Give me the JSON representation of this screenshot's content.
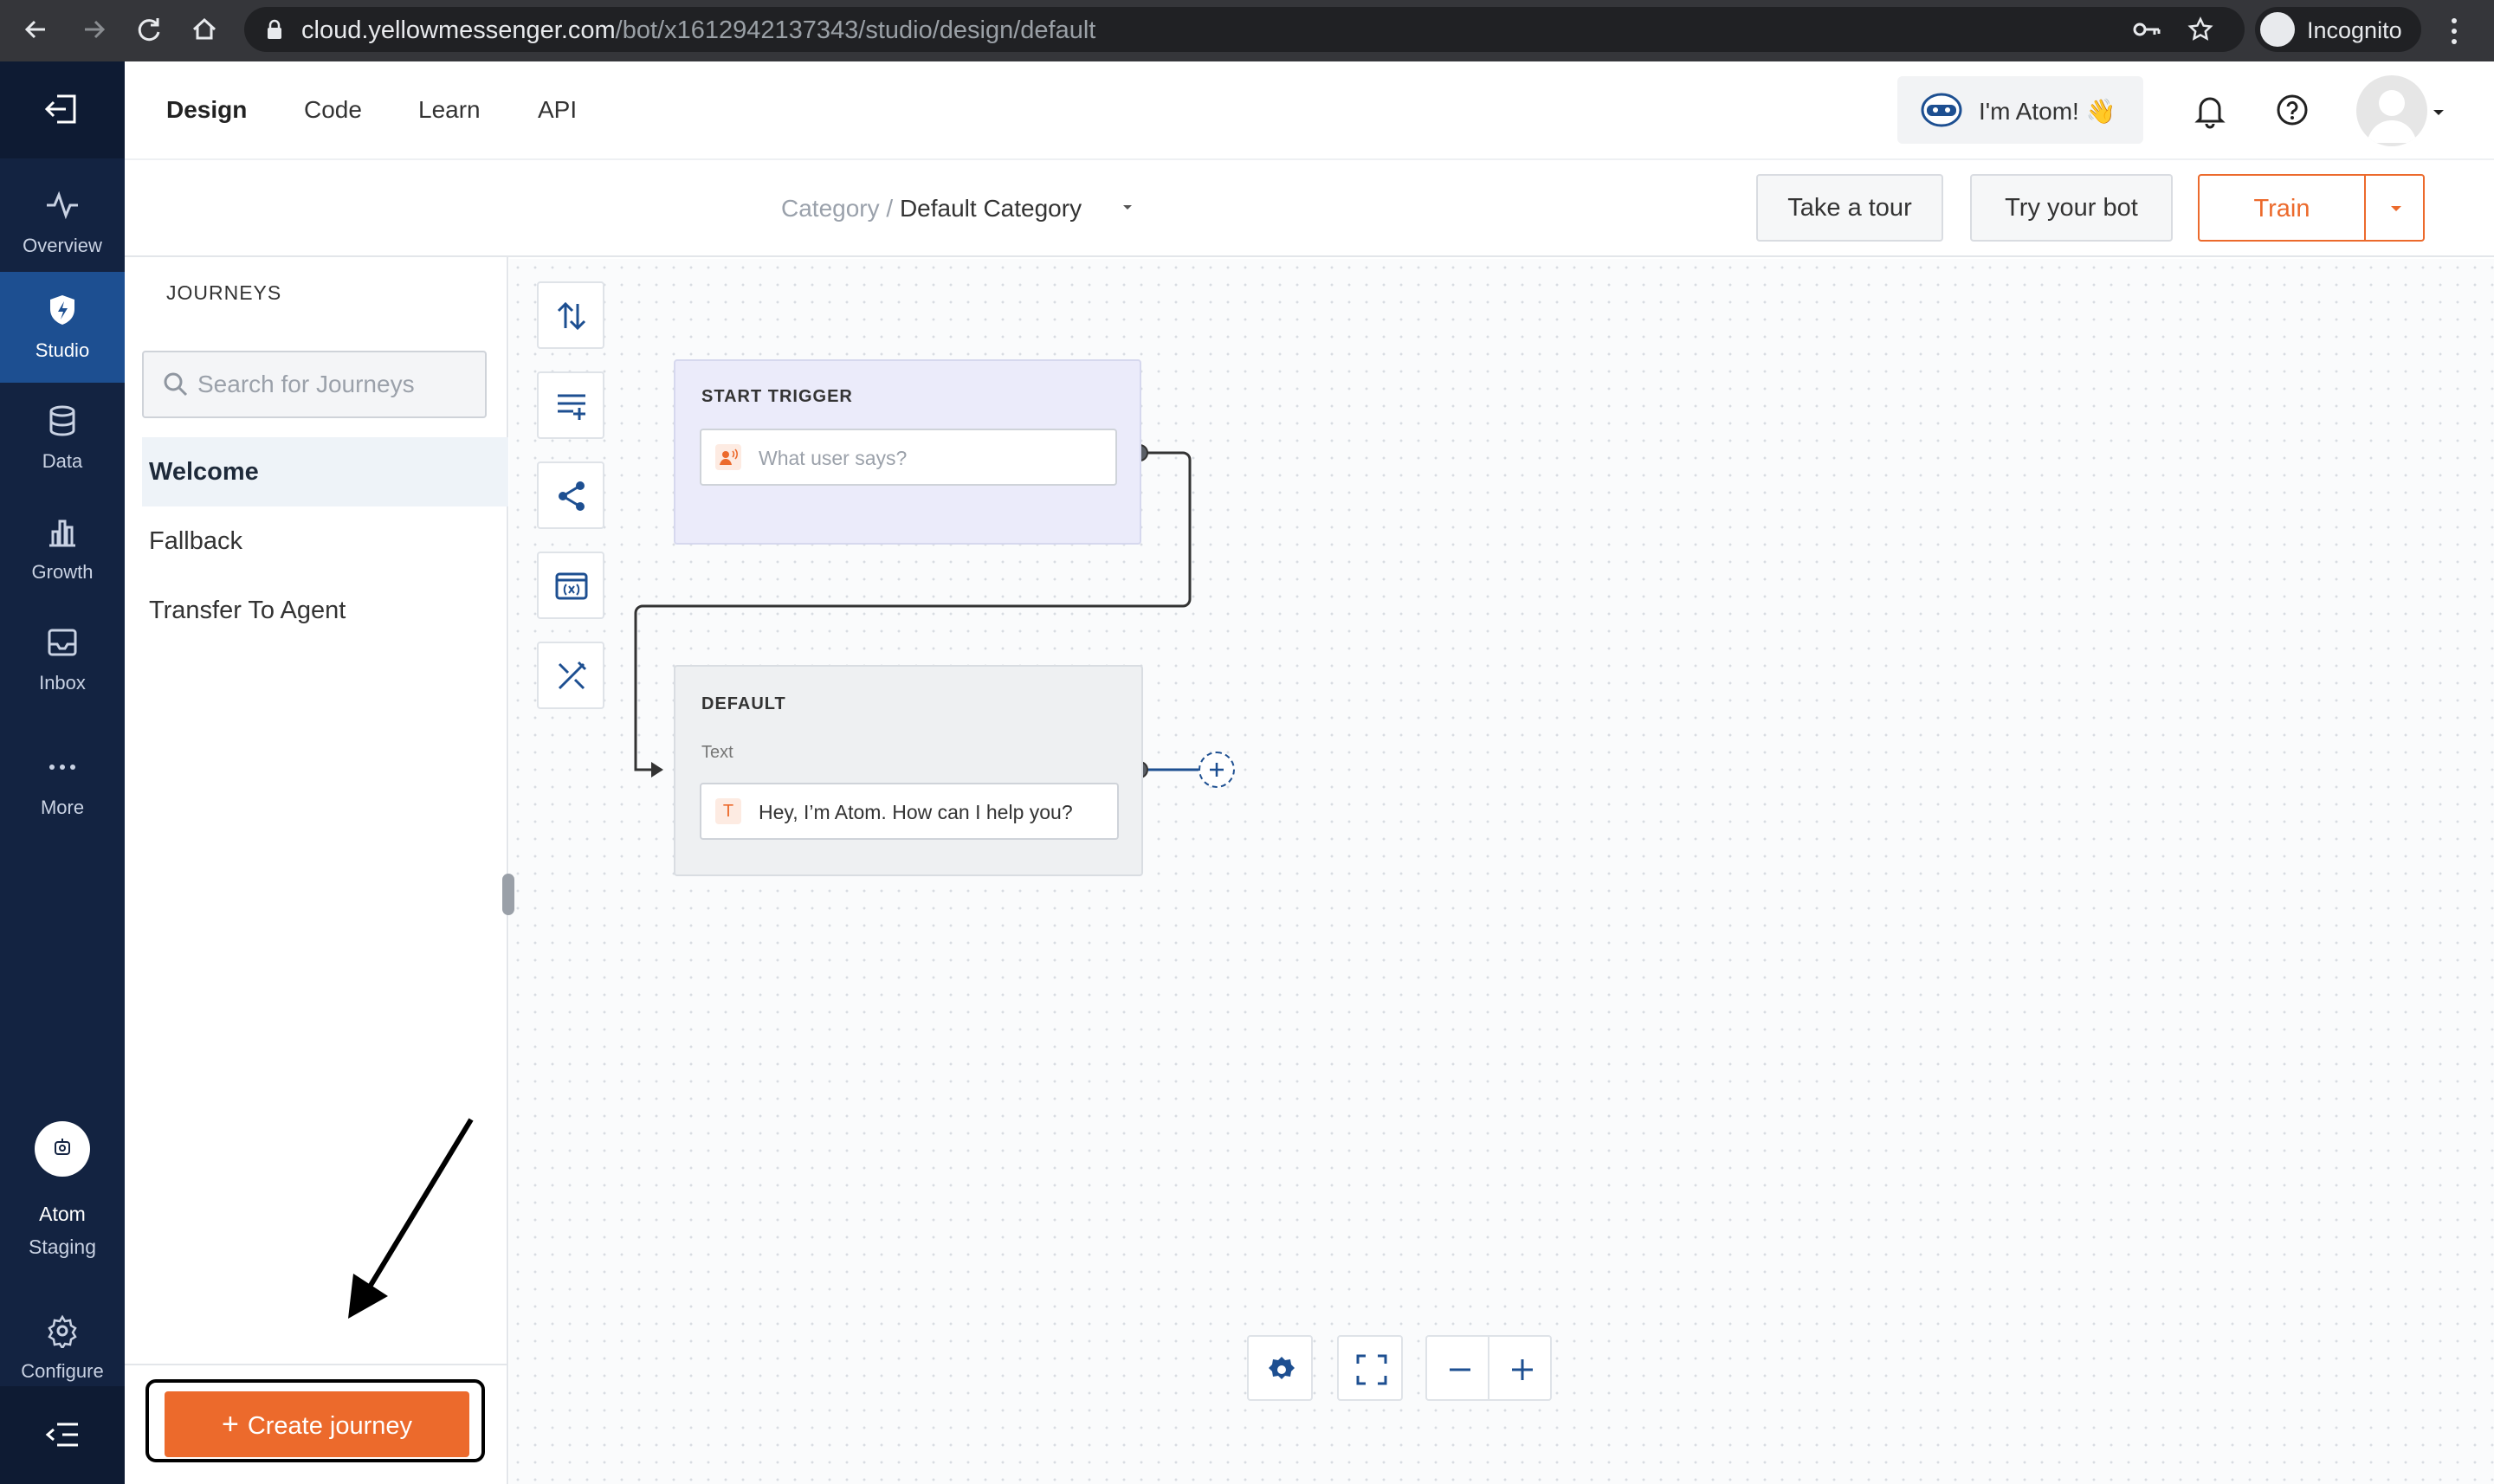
{
  "browser": {
    "url_host": "cloud.yellowmessenger.com",
    "url_path": "/bot/x1612942137343/studio/design/default",
    "incognito_label": "Incognito"
  },
  "leftnav": {
    "items": [
      {
        "label": "Overview",
        "icon": "activity-icon"
      },
      {
        "label": "Studio",
        "icon": "shield-bolt-icon",
        "active": true
      },
      {
        "label": "Data",
        "icon": "database-icon"
      },
      {
        "label": "Growth",
        "icon": "bar-chart-icon"
      },
      {
        "label": "Inbox",
        "icon": "inbox-icon"
      },
      {
        "label": "More",
        "icon": "more-dots-icon"
      }
    ],
    "bot_name_line1": "Atom",
    "bot_name_line2": "Staging",
    "configure_label": "Configure"
  },
  "header": {
    "tabs": [
      "Design",
      "Code",
      "Learn",
      "API"
    ],
    "active_tab": "Design",
    "atom_label": "I'm Atom! 👋"
  },
  "subheader": {
    "category_prefix": "Category /",
    "category_value": "Default Category",
    "take_tour": "Take a tour",
    "try_bot": "Try your bot",
    "train": "Train"
  },
  "journeys": {
    "title": "JOURNEYS",
    "search_placeholder": "Search for Journeys",
    "items": [
      {
        "label": "Welcome",
        "active": true
      },
      {
        "label": "Fallback"
      },
      {
        "label": "Transfer To Agent"
      }
    ],
    "create_label": "Create journey"
  },
  "flow": {
    "start_node": {
      "title": "START TRIGGER",
      "placeholder": "What user says?"
    },
    "default_node": {
      "title": "DEFAULT",
      "type_label": "Text",
      "message": "Hey, I’m Atom. How can I help you?",
      "type_glyph": "T"
    }
  },
  "colors": {
    "accent": "#ec6a2c",
    "nav_bg": "#132341",
    "nav_active": "#1d4f91",
    "start_node_bg": "#ebebfa",
    "default_node_bg": "#eef0f2"
  }
}
